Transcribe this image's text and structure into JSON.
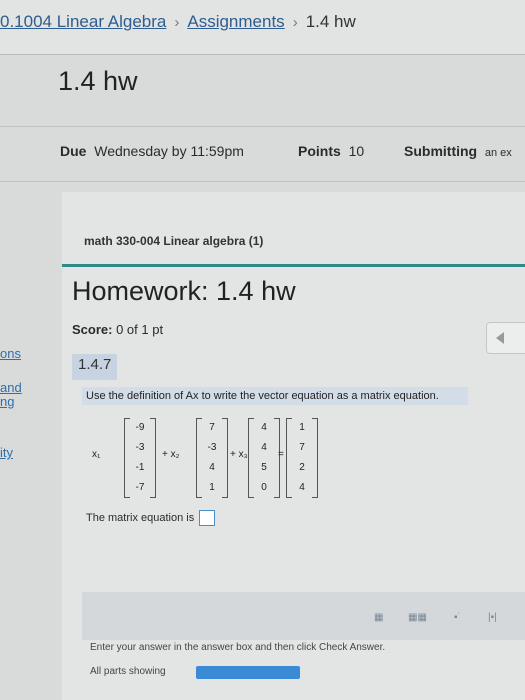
{
  "breadcrumb": {
    "course": "0.1004 Linear Algebra",
    "section": "Assignments",
    "current": "1.4 hw",
    "separator": "›"
  },
  "assignment": {
    "title": "1.4 hw",
    "due_label": "Due",
    "due_value": "Wednesday by 11:59pm",
    "points_label": "Points",
    "points_value": "10",
    "submitting_label": "Submitting",
    "submitting_value": "an ex"
  },
  "left_nav": [
    "ons",
    "and",
    "ng",
    "ity"
  ],
  "homework": {
    "course_name": "math 330-004 Linear algebra (1)",
    "heading": "Homework: 1.4 hw",
    "score_label": "Score:",
    "score_value": "0 of 1 pt",
    "question_number": "1.4.7",
    "instructions": "Use the definition of Ax to write the vector equation as a matrix equation.",
    "vectors": [
      [
        "-9",
        "-3",
        "-1",
        "-7"
      ],
      [
        "7",
        "-3",
        "4",
        "1"
      ],
      [
        "4",
        "4",
        "5",
        "0"
      ],
      [
        "1",
        "7",
        "2",
        "4"
      ]
    ],
    "coef_labels": [
      "x₁",
      "+ x₂",
      "+ x₃",
      "="
    ],
    "matrix_eq_label": "The matrix equation is",
    "footer_hint": "Enter your answer in the answer box and then click Check Answer.",
    "all_parts": "All parts showing"
  },
  "colors": {
    "accent_teal": "#2e8a8a",
    "link_blue": "#2e5d8f",
    "progress_blue": "#3a8ad6"
  }
}
